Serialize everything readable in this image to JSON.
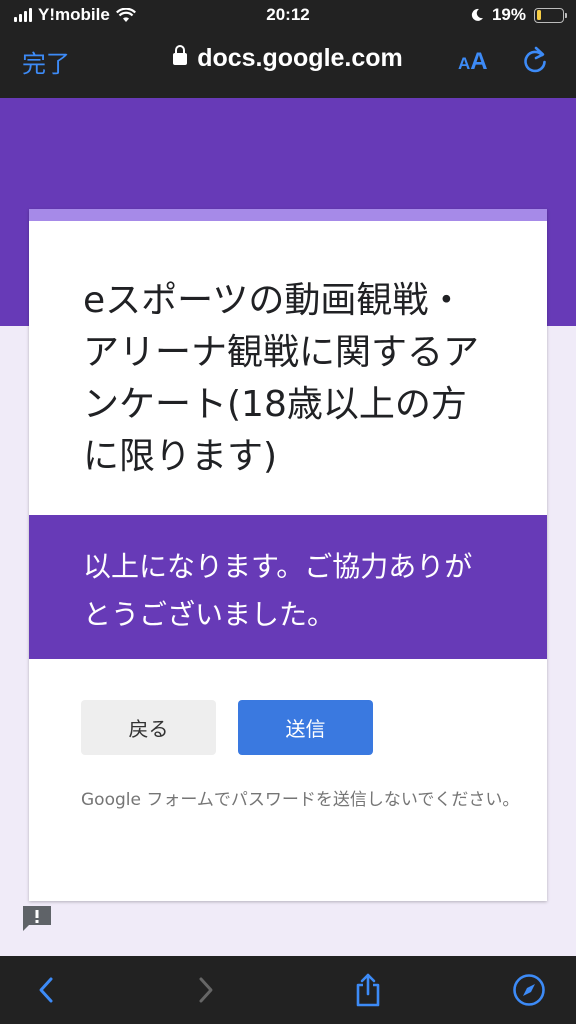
{
  "status_bar": {
    "carrier": "Y!mobile",
    "time": "20:12",
    "battery_percent": "19%",
    "battery_level": 0.19,
    "icons": [
      "signal-icon",
      "wifi-icon",
      "moon-icon",
      "battery-icon"
    ]
  },
  "browser": {
    "done_label": "完了",
    "url": "docs.google.com",
    "text_size_label": "AA"
  },
  "form": {
    "title": "eスポーツの動画観戦・アリーナ観戦に関するアンケート(18歳以上の方に限ります)",
    "message": "以上になります。ご協力ありがとうございました。",
    "back_label": "戻る",
    "submit_label": "送信",
    "notice": "Google フォームでパスワードを送信しないでください。"
  },
  "colors": {
    "accent": "#673ab7",
    "submit": "#3a79e0",
    "ios_blue": "#3d8bf7"
  }
}
